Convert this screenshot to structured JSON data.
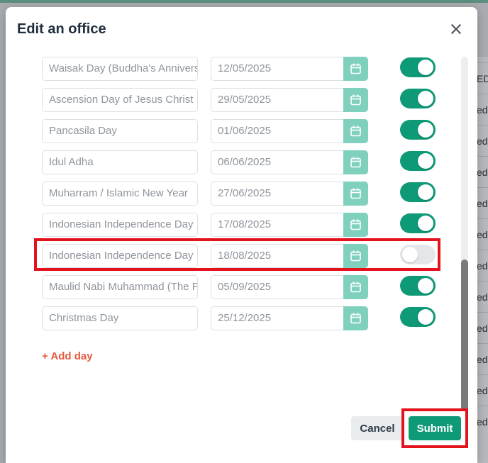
{
  "background": {
    "table_cells": [
      "EDU",
      "edu",
      "edu",
      "edu",
      "edu",
      "edu",
      "edu",
      "edu",
      "edu",
      "edu",
      "edu",
      "edu"
    ]
  },
  "modal": {
    "title": "Edit an office",
    "close_icon": "close-icon"
  },
  "holidays": [
    {
      "name": "Waisak Day (Buddha's Anniversary)",
      "date": "12/05/2025",
      "enabled": true
    },
    {
      "name": "Ascension Day of Jesus Christ",
      "date": "29/05/2025",
      "enabled": true
    },
    {
      "name": "Pancasila Day",
      "date": "01/06/2025",
      "enabled": true
    },
    {
      "name": "Idul Adha",
      "date": "06/06/2025",
      "enabled": true
    },
    {
      "name": "Muharram / Islamic New Year",
      "date": "27/06/2025",
      "enabled": true
    },
    {
      "name": "Indonesian Independence Day",
      "date": "17/08/2025",
      "enabled": true
    },
    {
      "name": "Indonesian Independence Day",
      "date": "18/08/2025",
      "enabled": false
    },
    {
      "name": "Maulid Nabi Muhammad (The Prophet's Birthday)",
      "date": "05/09/2025",
      "enabled": true
    },
    {
      "name": "Christmas Day",
      "date": "25/12/2025",
      "enabled": true
    }
  ],
  "add_day_label": "+ Add day",
  "footer": {
    "cancel_label": "Cancel",
    "submit_label": "Submit"
  },
  "colors": {
    "accent": "#0e9a77",
    "date_button": "#7fd1bd",
    "add_day": "#e8573d",
    "highlight": "#e3131e"
  }
}
